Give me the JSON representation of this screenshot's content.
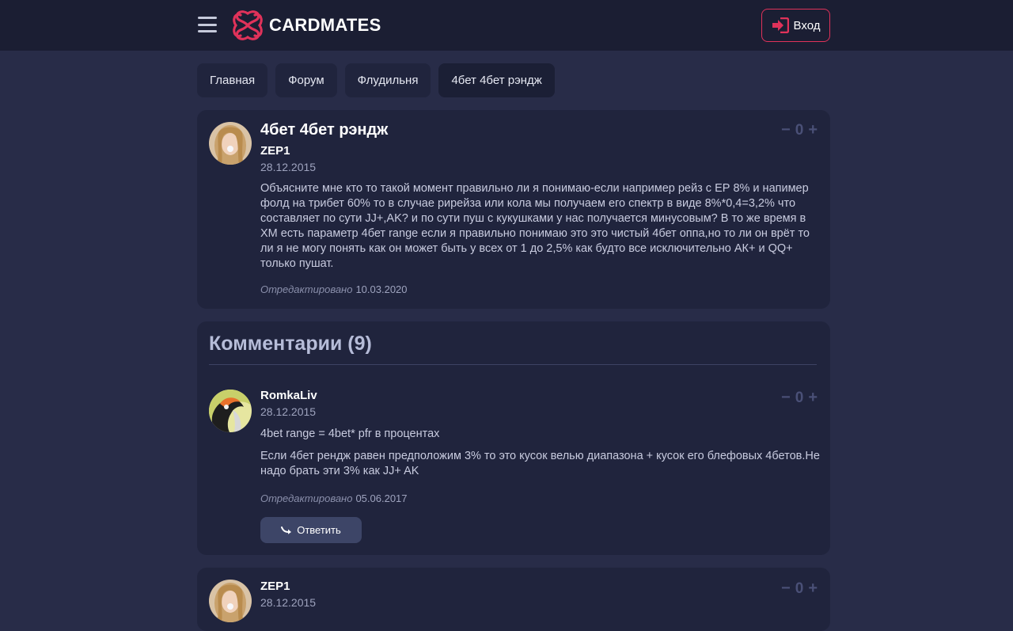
{
  "header": {
    "logo_text": "CARDMATES",
    "login_label": "Вход"
  },
  "breadcrumbs": [
    {
      "label": "Главная"
    },
    {
      "label": "Форум"
    },
    {
      "label": "Флудильня"
    },
    {
      "label": "4бет 4бет рэндж"
    }
  ],
  "post": {
    "title": "4бет 4бет рэндж",
    "author": "ZEP1",
    "date": "28.12.2015",
    "text": "Объясните мне кто то такой момент правильно ли я понимаю-если например рейз с ЕР 8% и напимер фолд на трибет 60% то в случае рирейза или кола мы получаем его спектр в виде 8%*0,4=3,2% что составляет по сути JJ+,AK? и по сути пуш с кукушками у нас получается минусовым? В то же время в ХМ есть параметр 4бет range если я правильно понимаю это это чистый 4бет оппа,но то ли он врёт то ли я не могу понять как он может быть у всех от 1 до 2,5% как будто все исключительно АК+ и QQ+ только пушат.",
    "edited_label": "Отредактировано",
    "edited_date": "10.03.2020",
    "vote_minus": "−",
    "votes": "0",
    "vote_plus": "+"
  },
  "comments": {
    "heading": "Комментарии (9)",
    "items": [
      {
        "author": "RomkaLiv",
        "date": "28.12.2015",
        "text1": "4bet range = 4bet* pfr в процентах",
        "text2": "Если 4бет рендж равен предположим 3% то это кусок велью диапазона + кусок его блефовых 4бетов.Не надо брать эти 3% как JJ+ AK",
        "edited_label": "Отредактировано",
        "edited_date": "05.06.2017",
        "reply_label": "Ответить",
        "vote_minus": "−",
        "votes": "0",
        "vote_plus": "+"
      },
      {
        "author": "ZEP1",
        "date": "28.12.2015",
        "vote_minus": "−",
        "votes": "0",
        "vote_plus": "+"
      }
    ]
  },
  "colors": {
    "accent": "#e0325a",
    "background": "#282c48",
    "header": "#1b1e33",
    "card": "#20243d"
  }
}
